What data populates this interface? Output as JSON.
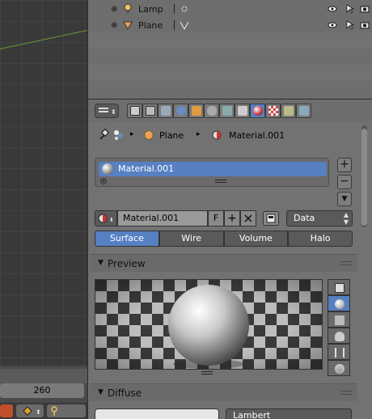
{
  "outliner": {
    "rows": [
      {
        "label": "Lamp"
      },
      {
        "label": "Plane"
      }
    ]
  },
  "timeline": {
    "frame_value": "260"
  },
  "breadcrumb": {
    "object": "Plane",
    "material": "Material.001"
  },
  "slot_list": {
    "items": [
      {
        "label": "Material.001"
      }
    ]
  },
  "material": {
    "name": "Material.001",
    "fake_user_label": "F",
    "link_type": "Data"
  },
  "type_tabs": [
    {
      "label": "Surface",
      "active": true
    },
    {
      "label": "Wire",
      "active": false
    },
    {
      "label": "Volume",
      "active": false
    },
    {
      "label": "Halo",
      "active": false
    }
  ],
  "panels": {
    "preview_title": "Preview",
    "diffuse_title": "Diffuse"
  },
  "diffuse": {
    "shader": "Lambert",
    "color": "#e6e6e6"
  },
  "colors": {
    "accent": "#5680c2",
    "panel_bg": "#727272",
    "viewport_bg": "#393939"
  }
}
